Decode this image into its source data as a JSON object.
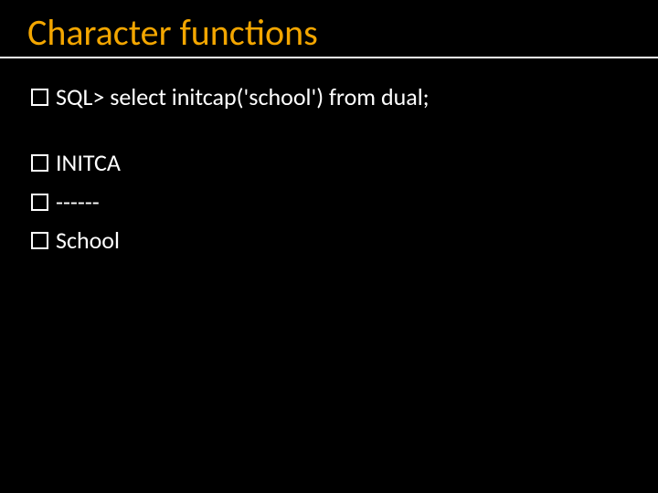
{
  "title": "Character functions",
  "lines": {
    "l1": "SQL> select initcap('school') from dual;",
    "l2": "INITCA",
    "l3": "------",
    "l4": "School"
  }
}
